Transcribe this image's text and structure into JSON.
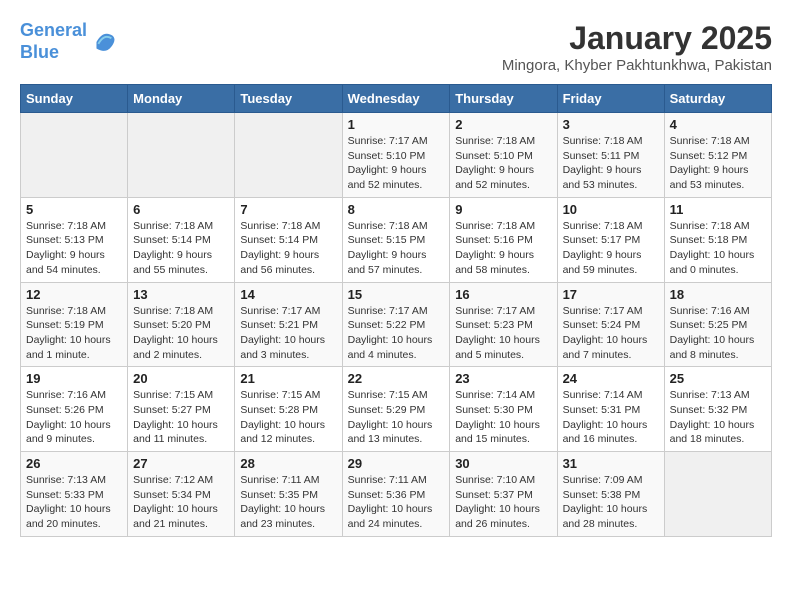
{
  "header": {
    "logo_line1": "General",
    "logo_line2": "Blue",
    "title": "January 2025",
    "subtitle": "Mingora, Khyber Pakhtunkhwa, Pakistan"
  },
  "weekdays": [
    "Sunday",
    "Monday",
    "Tuesday",
    "Wednesday",
    "Thursday",
    "Friday",
    "Saturday"
  ],
  "weeks": [
    [
      {
        "day": "",
        "info": ""
      },
      {
        "day": "",
        "info": ""
      },
      {
        "day": "",
        "info": ""
      },
      {
        "day": "1",
        "info": "Sunrise: 7:17 AM\nSunset: 5:10 PM\nDaylight: 9 hours and 52 minutes."
      },
      {
        "day": "2",
        "info": "Sunrise: 7:18 AM\nSunset: 5:10 PM\nDaylight: 9 hours and 52 minutes."
      },
      {
        "day": "3",
        "info": "Sunrise: 7:18 AM\nSunset: 5:11 PM\nDaylight: 9 hours and 53 minutes."
      },
      {
        "day": "4",
        "info": "Sunrise: 7:18 AM\nSunset: 5:12 PM\nDaylight: 9 hours and 53 minutes."
      }
    ],
    [
      {
        "day": "5",
        "info": "Sunrise: 7:18 AM\nSunset: 5:13 PM\nDaylight: 9 hours and 54 minutes."
      },
      {
        "day": "6",
        "info": "Sunrise: 7:18 AM\nSunset: 5:14 PM\nDaylight: 9 hours and 55 minutes."
      },
      {
        "day": "7",
        "info": "Sunrise: 7:18 AM\nSunset: 5:14 PM\nDaylight: 9 hours and 56 minutes."
      },
      {
        "day": "8",
        "info": "Sunrise: 7:18 AM\nSunset: 5:15 PM\nDaylight: 9 hours and 57 minutes."
      },
      {
        "day": "9",
        "info": "Sunrise: 7:18 AM\nSunset: 5:16 PM\nDaylight: 9 hours and 58 minutes."
      },
      {
        "day": "10",
        "info": "Sunrise: 7:18 AM\nSunset: 5:17 PM\nDaylight: 9 hours and 59 minutes."
      },
      {
        "day": "11",
        "info": "Sunrise: 7:18 AM\nSunset: 5:18 PM\nDaylight: 10 hours and 0 minutes."
      }
    ],
    [
      {
        "day": "12",
        "info": "Sunrise: 7:18 AM\nSunset: 5:19 PM\nDaylight: 10 hours and 1 minute."
      },
      {
        "day": "13",
        "info": "Sunrise: 7:18 AM\nSunset: 5:20 PM\nDaylight: 10 hours and 2 minutes."
      },
      {
        "day": "14",
        "info": "Sunrise: 7:17 AM\nSunset: 5:21 PM\nDaylight: 10 hours and 3 minutes."
      },
      {
        "day": "15",
        "info": "Sunrise: 7:17 AM\nSunset: 5:22 PM\nDaylight: 10 hours and 4 minutes."
      },
      {
        "day": "16",
        "info": "Sunrise: 7:17 AM\nSunset: 5:23 PM\nDaylight: 10 hours and 5 minutes."
      },
      {
        "day": "17",
        "info": "Sunrise: 7:17 AM\nSunset: 5:24 PM\nDaylight: 10 hours and 7 minutes."
      },
      {
        "day": "18",
        "info": "Sunrise: 7:16 AM\nSunset: 5:25 PM\nDaylight: 10 hours and 8 minutes."
      }
    ],
    [
      {
        "day": "19",
        "info": "Sunrise: 7:16 AM\nSunset: 5:26 PM\nDaylight: 10 hours and 9 minutes."
      },
      {
        "day": "20",
        "info": "Sunrise: 7:15 AM\nSunset: 5:27 PM\nDaylight: 10 hours and 11 minutes."
      },
      {
        "day": "21",
        "info": "Sunrise: 7:15 AM\nSunset: 5:28 PM\nDaylight: 10 hours and 12 minutes."
      },
      {
        "day": "22",
        "info": "Sunrise: 7:15 AM\nSunset: 5:29 PM\nDaylight: 10 hours and 13 minutes."
      },
      {
        "day": "23",
        "info": "Sunrise: 7:14 AM\nSunset: 5:30 PM\nDaylight: 10 hours and 15 minutes."
      },
      {
        "day": "24",
        "info": "Sunrise: 7:14 AM\nSunset: 5:31 PM\nDaylight: 10 hours and 16 minutes."
      },
      {
        "day": "25",
        "info": "Sunrise: 7:13 AM\nSunset: 5:32 PM\nDaylight: 10 hours and 18 minutes."
      }
    ],
    [
      {
        "day": "26",
        "info": "Sunrise: 7:13 AM\nSunset: 5:33 PM\nDaylight: 10 hours and 20 minutes."
      },
      {
        "day": "27",
        "info": "Sunrise: 7:12 AM\nSunset: 5:34 PM\nDaylight: 10 hours and 21 minutes."
      },
      {
        "day": "28",
        "info": "Sunrise: 7:11 AM\nSunset: 5:35 PM\nDaylight: 10 hours and 23 minutes."
      },
      {
        "day": "29",
        "info": "Sunrise: 7:11 AM\nSunset: 5:36 PM\nDaylight: 10 hours and 24 minutes."
      },
      {
        "day": "30",
        "info": "Sunrise: 7:10 AM\nSunset: 5:37 PM\nDaylight: 10 hours and 26 minutes."
      },
      {
        "day": "31",
        "info": "Sunrise: 7:09 AM\nSunset: 5:38 PM\nDaylight: 10 hours and 28 minutes."
      },
      {
        "day": "",
        "info": ""
      }
    ]
  ]
}
